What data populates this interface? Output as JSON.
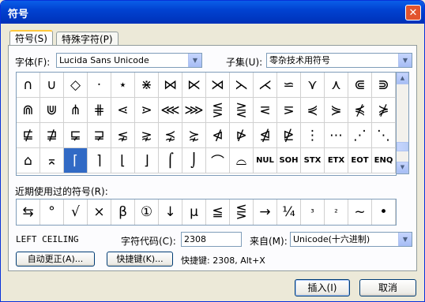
{
  "window": {
    "title": "符号",
    "close": "✕"
  },
  "tabs": [
    "符号(S)",
    "特殊字符(P)"
  ],
  "font": {
    "label": "字体(F):",
    "value": "Lucida Sans Unicode"
  },
  "subset": {
    "label": "子集(U):",
    "value": "零杂技术用符号"
  },
  "symbols": [
    [
      "∩",
      "∪",
      "◇",
      "·",
      "⋆",
      "⋇",
      "⋈",
      "⋉",
      "⋊",
      "⋋",
      "⋌",
      "⋍",
      "⋎",
      "⋏",
      "⋐",
      "⋑"
    ],
    [
      "⋒",
      "⋓",
      "⋔",
      "⋕",
      "⋖",
      "⋗",
      "⋘",
      "⋙",
      "⋚",
      "⋛",
      "⋜",
      "⋝",
      "⋞",
      "⋟",
      "⋠",
      "⋡"
    ],
    [
      "⋢",
      "⋣",
      "⋤",
      "⋥",
      "⋦",
      "⋧",
      "⋨",
      "⋩",
      "⋪",
      "⋫",
      "⋬",
      "⋭",
      "⋮",
      "⋯",
      "⋰",
      "⋱"
    ],
    [
      "⌂",
      "⌅",
      "⌈",
      "⌉",
      "⌊",
      "⌋",
      "⌠",
      "⌡",
      "⌒",
      "⌓",
      "NUL",
      "SOH",
      "STX",
      "ETX",
      "EOT",
      "ENQ"
    ]
  ],
  "recent": {
    "label": "近期使用过的符号(R):",
    "items": [
      "⇆",
      "°",
      "√",
      "×",
      "β",
      "①",
      "↓",
      "μ",
      "≦",
      "⋚",
      "→",
      "¼",
      "³",
      "²",
      "~",
      "•"
    ]
  },
  "char_name": "LEFT CEILING",
  "char_code": {
    "label": "字符代码(C):",
    "value": "2308"
  },
  "from": {
    "label": "来自(M):",
    "value": "Unicode(十六进制)"
  },
  "buttons": {
    "autocorrect": "自动更正(A)...",
    "shortcut": "快捷键(K)...",
    "insert": "插入(I)",
    "cancel": "取消"
  },
  "shortcut_info": "快捷键: 2308, Alt+X"
}
